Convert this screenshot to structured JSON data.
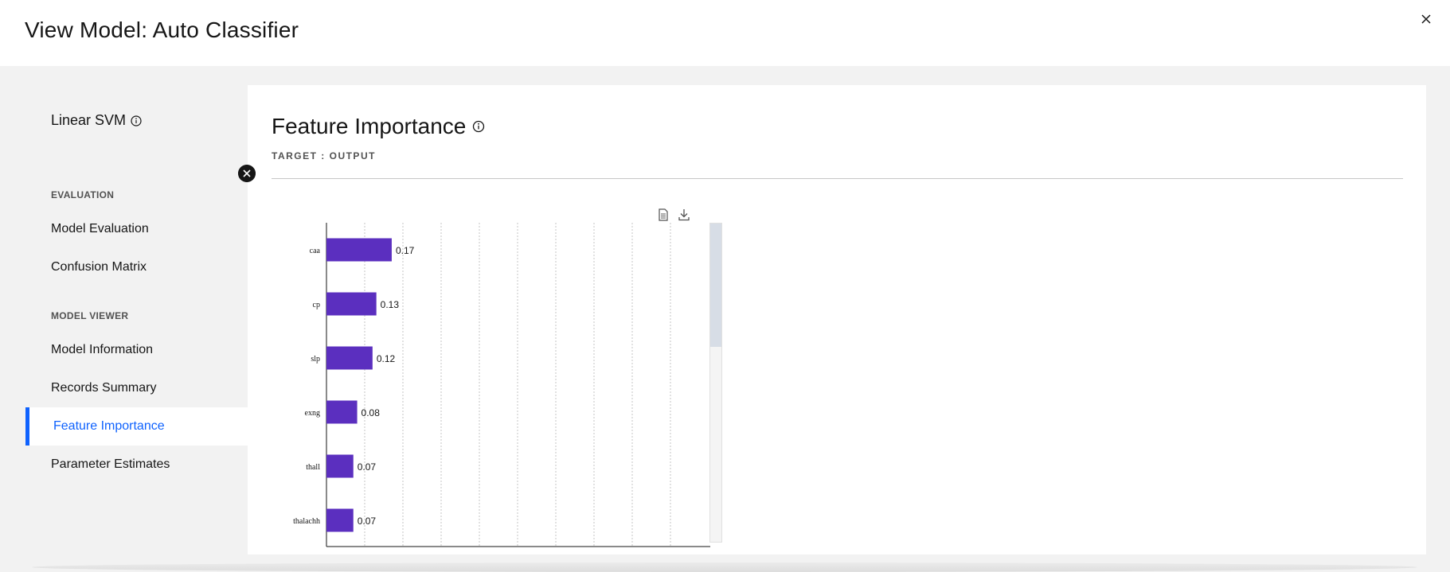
{
  "window": {
    "title": "View Model: Auto Classifier"
  },
  "sidebar": {
    "model_name": "Linear SVM",
    "sections": [
      {
        "label": "EVALUATION",
        "items": [
          "Model Evaluation",
          "Confusion Matrix"
        ]
      },
      {
        "label": "MODEL VIEWER",
        "items": [
          "Model Information",
          "Records Summary",
          "Feature Importance",
          "Parameter Estimates"
        ]
      }
    ],
    "active_item": "Feature Importance"
  },
  "panel": {
    "title": "Feature Importance",
    "subtitle": "TARGET : OUTPUT"
  },
  "colors": {
    "bar": "#5b2fbf",
    "accent": "#0f62fe"
  },
  "icons": [
    "close-icon",
    "info-icon",
    "collapse-icon",
    "document-icon",
    "download-icon"
  ],
  "chart_data": {
    "type": "bar",
    "orientation": "horizontal",
    "categories": [
      "caa",
      "cp",
      "slp",
      "exng",
      "thall",
      "thalachh"
    ],
    "values": [
      0.17,
      0.13,
      0.12,
      0.08,
      0.07,
      0.07
    ],
    "value_labels": [
      "0.17",
      "0.13",
      "0.12",
      "0.08",
      "0.07",
      "0.07"
    ],
    "xlim": [
      0,
      1
    ],
    "grid": true
  }
}
